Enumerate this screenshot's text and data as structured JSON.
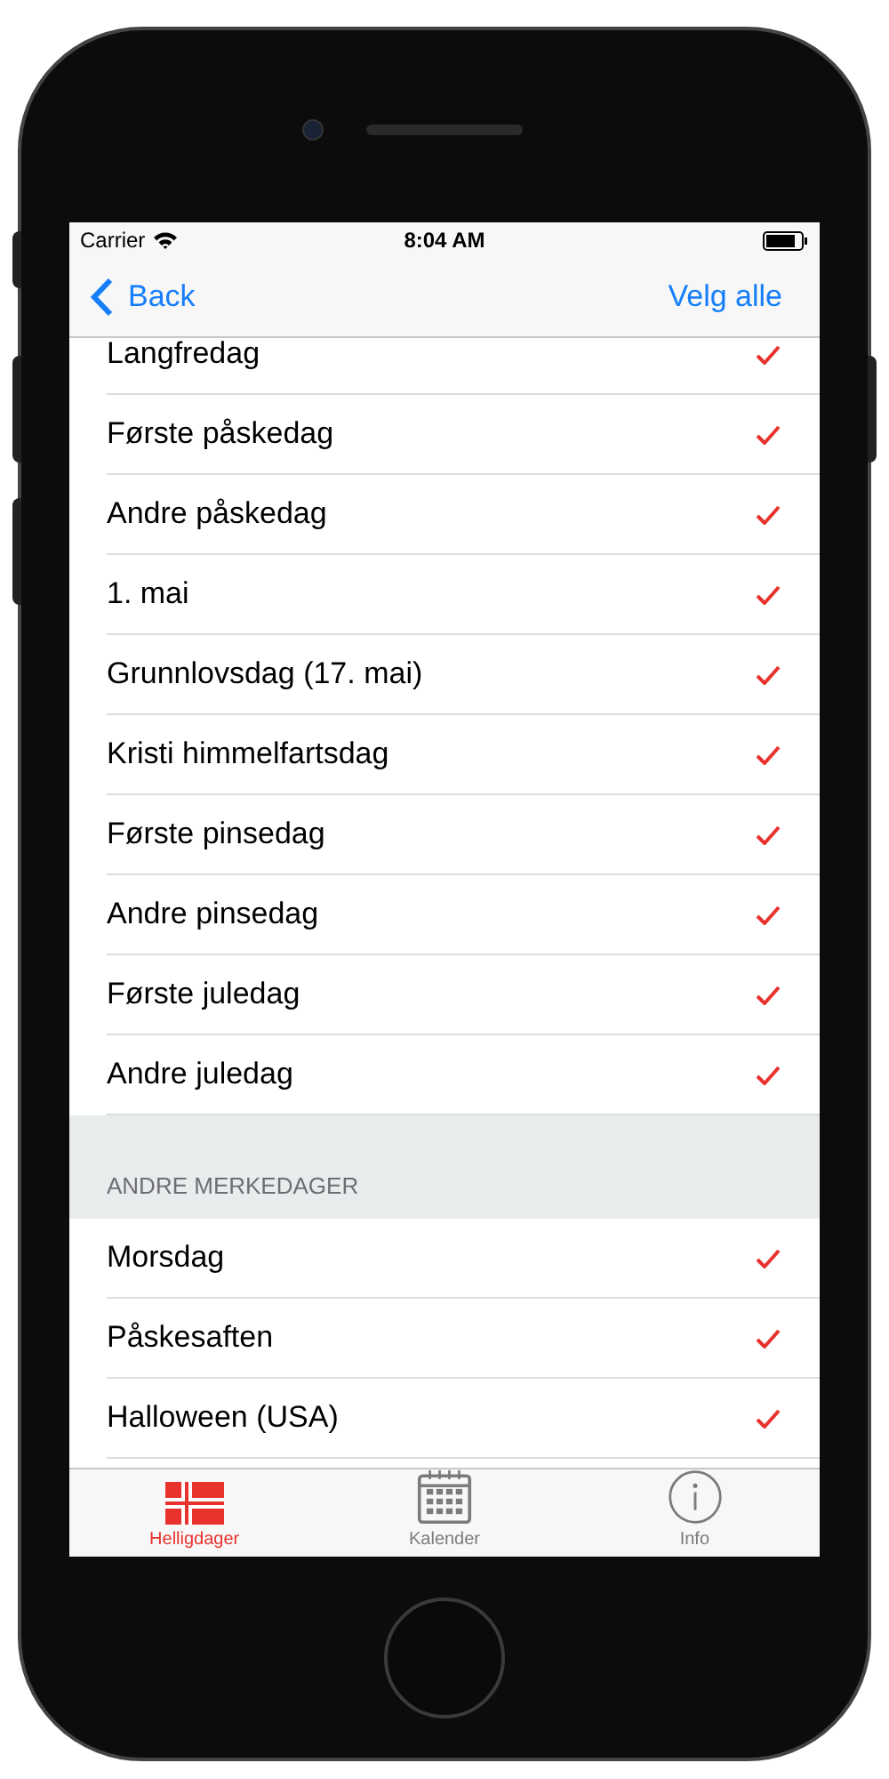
{
  "status_bar": {
    "carrier": "Carrier",
    "time": "8:04 AM"
  },
  "nav": {
    "back": "Back",
    "action": "Velg alle"
  },
  "sections": [
    {
      "items": [
        {
          "label": "Langfredag",
          "checked": true
        },
        {
          "label": "Første påskedag",
          "checked": true
        },
        {
          "label": "Andre påskedag",
          "checked": true
        },
        {
          "label": "1. mai",
          "checked": true
        },
        {
          "label": "Grunnlovsdag (17. mai)",
          "checked": true
        },
        {
          "label": "Kristi himmelfartsdag",
          "checked": true
        },
        {
          "label": "Første pinsedag",
          "checked": true
        },
        {
          "label": "Andre pinsedag",
          "checked": true
        },
        {
          "label": "Første juledag",
          "checked": true
        },
        {
          "label": "Andre juledag",
          "checked": true
        }
      ]
    },
    {
      "header": "ANDRE MERKEDAGER",
      "items": [
        {
          "label": "Morsdag",
          "checked": true
        },
        {
          "label": "Påskesaften",
          "checked": true
        },
        {
          "label": "Halloween (USA)",
          "checked": true
        }
      ]
    }
  ],
  "tab_bar": [
    {
      "kind": "flag",
      "label": "Helligdager",
      "selected": true
    },
    {
      "kind": "calendar",
      "label": "Kalender",
      "selected": false
    },
    {
      "kind": "info",
      "label": "Info",
      "selected": false
    }
  ]
}
